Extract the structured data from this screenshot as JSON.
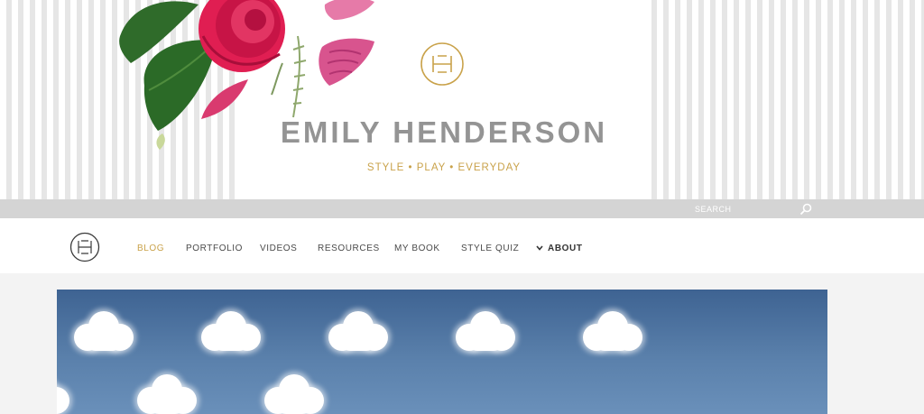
{
  "site": {
    "title": "EMILY HENDERSON",
    "tagline": "STYLE • PLAY • EVERYDAY"
  },
  "search": {
    "placeholder": "SEARCH"
  },
  "nav": {
    "items": [
      {
        "label": "BLOG",
        "active": true
      },
      {
        "label": "PORTFOLIO",
        "active": false
      },
      {
        "label": "VIDEOS",
        "active": false
      },
      {
        "label": "RESOURCES",
        "active": false
      },
      {
        "label": "MY BOOK",
        "active": false
      },
      {
        "label": "STYLE QUIZ",
        "active": false
      },
      {
        "label": "ABOUT",
        "active": false
      }
    ]
  },
  "icons": {
    "logo": "eh-monogram-icon",
    "search": "magnifier-icon",
    "about_chevron": "chevron-down-icon"
  },
  "colors": {
    "accent_gold": "#c9a24a",
    "title_grey": "#949494",
    "search_strip": "#d4d4d4",
    "hero_sky": "#4a6f9c"
  }
}
